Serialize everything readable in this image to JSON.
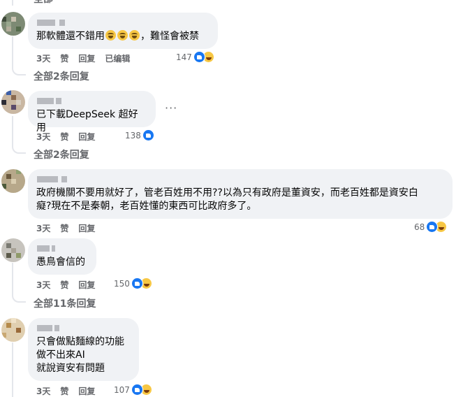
{
  "comments": [
    {
      "text_parts": [
        "那軟體還不錯用",
        "，難怪會被禁"
      ],
      "emoji_icons": [
        "laughing-emoji",
        "laughing-emoji",
        "laughing-emoji"
      ],
      "time": "3天",
      "like": "赞",
      "reply": "回复",
      "edited": "已编辑",
      "reaction_count": "147",
      "reactions": [
        "like-icon",
        "haha-icon"
      ],
      "replies_link": "全部2条回复"
    },
    {
      "text": "已下載DeepSeek 超好用",
      "time": "3天",
      "like": "赞",
      "reply": "回复",
      "reaction_count": "138",
      "reactions": [
        "like-icon"
      ],
      "replies_link": "全部2条回复",
      "more": "···"
    },
    {
      "text": "政府機關不要用就好了，管老百姓用不用??以為只有政府是董資安，而老百姓都是資安白\n癡?現在不是秦朝，老百姓懂的東西可比政府多了。",
      "time": "3天",
      "like": "赞",
      "reply": "回复",
      "reaction_count": "68",
      "reactions": [
        "like-icon",
        "haha-icon"
      ]
    },
    {
      "text": "愚鳥會信的",
      "time": "3天",
      "like": "赞",
      "reply": "回复",
      "reaction_count": "150",
      "reactions": [
        "like-icon",
        "haha-icon"
      ],
      "replies_link": "全部11条回复"
    },
    {
      "text": "只會做點麵線的功能\n做不出來AI\n就說資安有問題",
      "time": "3天",
      "like": "赞",
      "reply": "回复",
      "reaction_count": "107",
      "reactions": [
        "like-icon",
        "haha-icon"
      ]
    }
  ],
  "colors": {
    "bubble": "#f0f2f5",
    "meta": "#65676b",
    "like_blue": "#1877f2",
    "haha_yellow": "#f7c744"
  }
}
